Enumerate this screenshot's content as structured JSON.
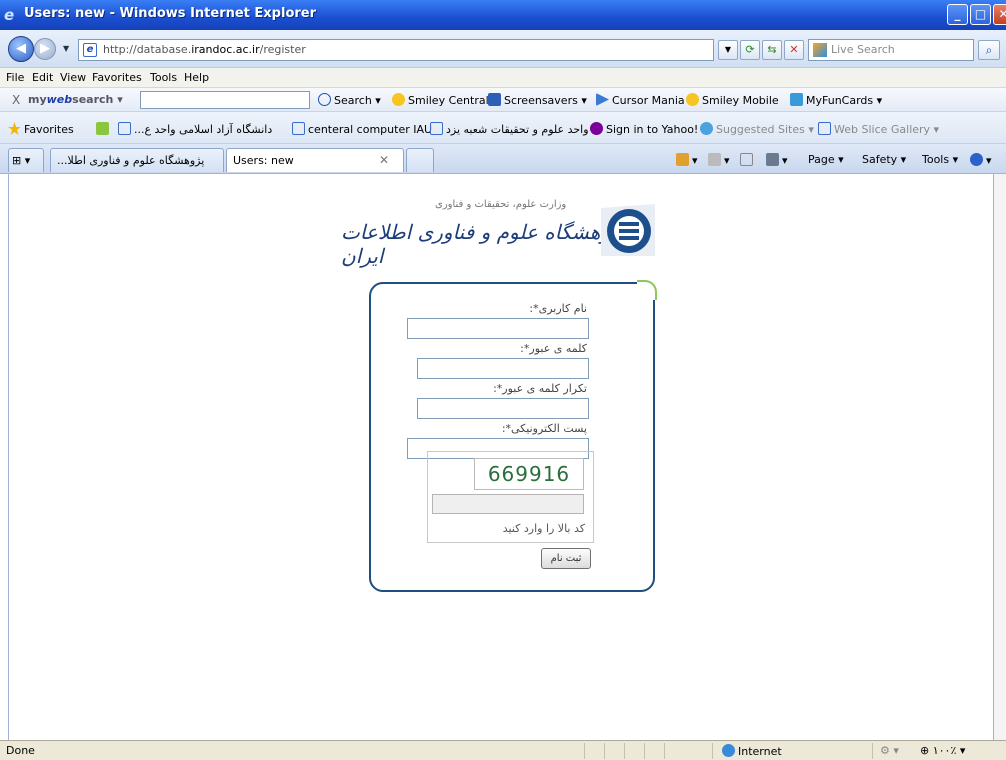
{
  "window": {
    "title": "Users: new - Windows Internet Explorer",
    "brand_color": "#2458d6"
  },
  "address": {
    "url_prefix": "http://database.",
    "url_domain": "irandoc.ac.ir",
    "url_path": "/register",
    "search_placeholder": "Live Search"
  },
  "menu": [
    "File",
    "Edit",
    "View",
    "Favorites",
    "Tools",
    "Help"
  ],
  "toolbar": {
    "close": "X",
    "brand_a": "my",
    "brand_b": "web",
    "brand_c": "search",
    "search_label": "Search",
    "items": [
      "Smiley Central",
      "Screensavers",
      "Cursor Mania",
      "Smiley Mobile",
      "MyFunCards"
    ]
  },
  "favorites": {
    "label": "Favorites",
    "items": [
      "...دانشگاه آزاد اسلامی واحد ع",
      "centeral computer IAU",
      "واحد علوم و تحقیقات شعبه یزد",
      "Sign in to Yahoo!",
      "Suggested Sites",
      "Web Slice Gallery"
    ]
  },
  "tabs": [
    {
      "label": "...پژوهشگاه علوم و فناوری اطلا"
    },
    {
      "label": "Users: new"
    }
  ],
  "commands": {
    "page": "Page",
    "safety": "Safety",
    "tools": "Tools"
  },
  "logo": {
    "subtitle": "وزارت علوم، تحقیقات و فناوری",
    "name": "پژوهشگاه علوم و فناوری اطلاعات ایران"
  },
  "form": {
    "username_label": "نام کاربری*:",
    "password_label": "کلمه ی عبور*:",
    "confirm_label": "تکرار کلمه ی عبور*:",
    "email_label": "پست الکترونیکی*:",
    "captcha_code": "669916",
    "captcha_hint": "کد بالا را وارد کنید",
    "submit_label": "ثبت نام"
  },
  "status": {
    "text": "Done",
    "zone": "Internet",
    "zoom": "۱۰۰٪"
  }
}
